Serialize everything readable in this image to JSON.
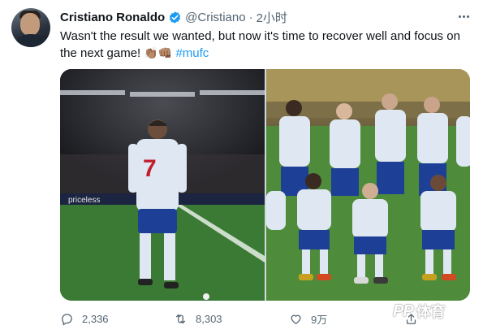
{
  "tweet": {
    "author": {
      "name": "Cristiano Ronaldo",
      "handle": "@Cristiano",
      "verified": true,
      "avatar_icon": "profile-photo"
    },
    "separator": "·",
    "time": "2小时",
    "text_line1": "Wasn't the result we wanted, but now it's time to recover well and focus on",
    "text_line2_prefix": "the next game! ",
    "emojis": [
      "👏🏽",
      "👊🏽"
    ],
    "hashtag": "#mufc",
    "media": [
      {
        "description": "player-number-7-on-pitch"
      },
      {
        "description": "team-photo"
      }
    ],
    "photo_left": {
      "board_text": "priceless",
      "jersey_number": "7"
    },
    "actions": {
      "replies": "2,336",
      "retweets": "8,303",
      "likes": "9万"
    },
    "watermark": {
      "logo": "PP",
      "text": "体育"
    },
    "colors": {
      "accent": "#1d9bf0",
      "text": "#0f1419",
      "secondary": "#536471",
      "verified_badge": "#1d9bf0",
      "kit_white": "#dfe7f2",
      "kit_blue": "#1e3f96"
    }
  }
}
